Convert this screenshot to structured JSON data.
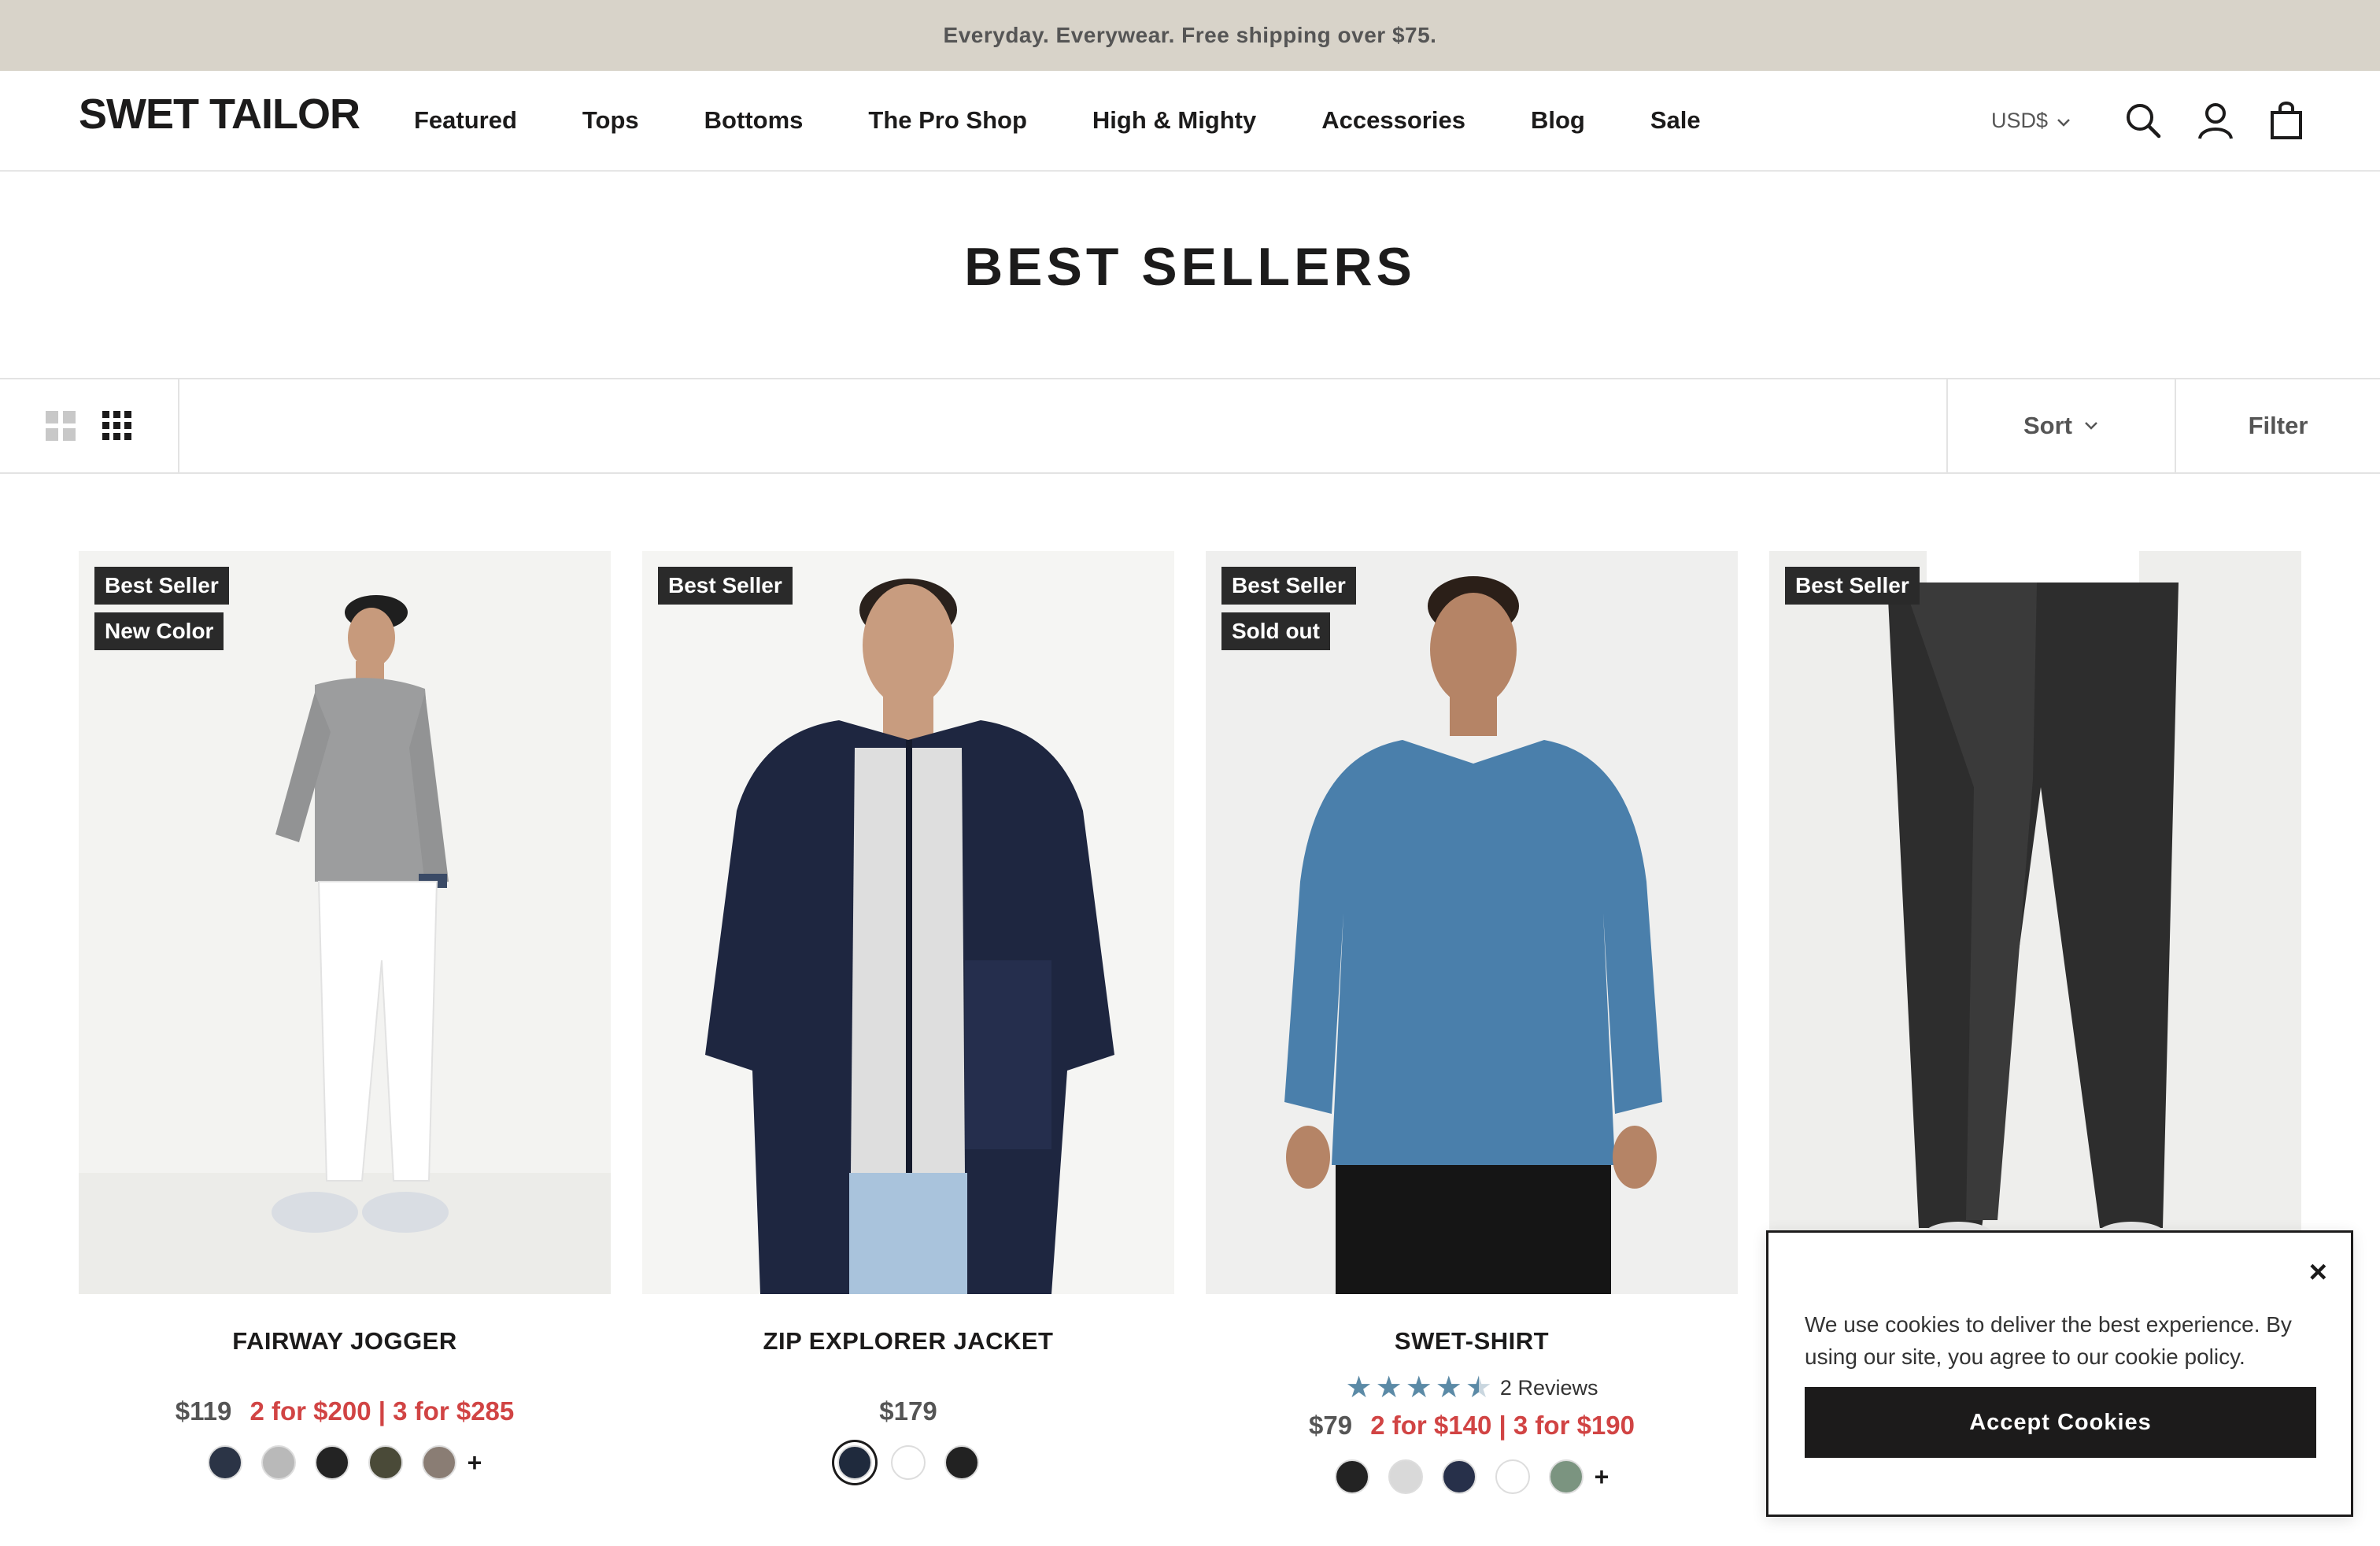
{
  "announcement": "Everyday. Everywear. Free shipping over $75.",
  "header": {
    "logo": "SWET TAILOR",
    "nav": [
      "Featured",
      "Tops",
      "Bottoms",
      "The Pro Shop",
      "High & Mighty",
      "Accessories",
      "Blog",
      "Sale"
    ],
    "currency": "USD$",
    "icons": [
      "search-icon",
      "account-icon",
      "cart-icon"
    ]
  },
  "page_title": "BEST SELLERS",
  "toolbar": {
    "sort_label": "Sort",
    "filter_label": "Filter",
    "view_icons": [
      "grid-2-icon",
      "grid-4-icon"
    ]
  },
  "products": [
    {
      "name": "FAIRWAY JOGGER",
      "badges": [
        "Best Seller",
        "New Color"
      ],
      "price": "$119",
      "deal": "2 for $200 | 3 for $285",
      "swatches": [
        "#2b3446",
        "#b9b9b9",
        "#232323",
        "#4a4a38",
        "#8a7d74"
      ],
      "more_colors": "+"
    },
    {
      "name": "ZIP EXPLORER JACKET",
      "badges": [
        "Best Seller"
      ],
      "price": "$179",
      "deal": "",
      "swatches": [
        "#1f2a3d",
        "#ffffff",
        "#222222"
      ],
      "selected_swatch": 0
    },
    {
      "name": "SWET-SHIRT",
      "badges": [
        "Best Seller",
        "Sold out"
      ],
      "rating": 4.5,
      "reviews": "2 Reviews",
      "price": "$79",
      "deal": "2 for $140 | 3 for $190",
      "swatches": [
        "#232323",
        "#d9d9d9",
        "#27304a",
        "#ffffff",
        "#7b9480"
      ],
      "more_colors": "+"
    },
    {
      "name": "",
      "badges": [
        "Best Seller"
      ]
    }
  ],
  "cookie": {
    "message": "We use cookies to deliver the best experience. By using our site, you agree to our cookie policy.",
    "accept": "Accept Cookies",
    "close": "×"
  },
  "colors": {
    "accent_red": "#d14444",
    "announcement_bg": "#d8d3c9",
    "star_blue": "#5b8aa6",
    "badge_bg": "#2a2a2a"
  }
}
